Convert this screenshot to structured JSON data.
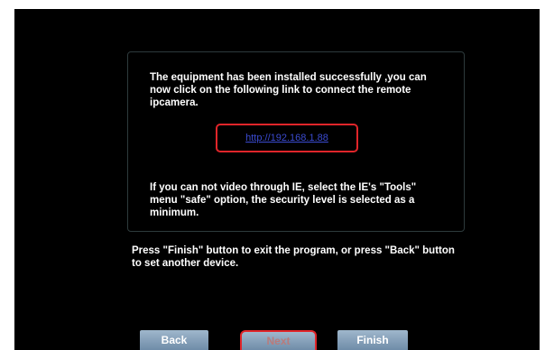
{
  "dialog": {
    "message_installed": "The equipment has been installed successfully ,you can now click on the following link to connect the remote ipcamera.",
    "camera_link": "http://192.168.1.88",
    "message_ie": "If you can not video through IE, select the IE's \"Tools\" menu  \"safe\" option, the security level is selected as a minimum.",
    "message_finish": "Press \"Finish\" button to exit the program, or press \"Back\" button to set another device."
  },
  "buttons": {
    "back_label": "Back",
    "next_label": "Next",
    "finish_label": "Finish"
  },
  "colors": {
    "highlight": "#e0252a",
    "link": "#3b4bd1",
    "button": "#7f9bb6"
  }
}
